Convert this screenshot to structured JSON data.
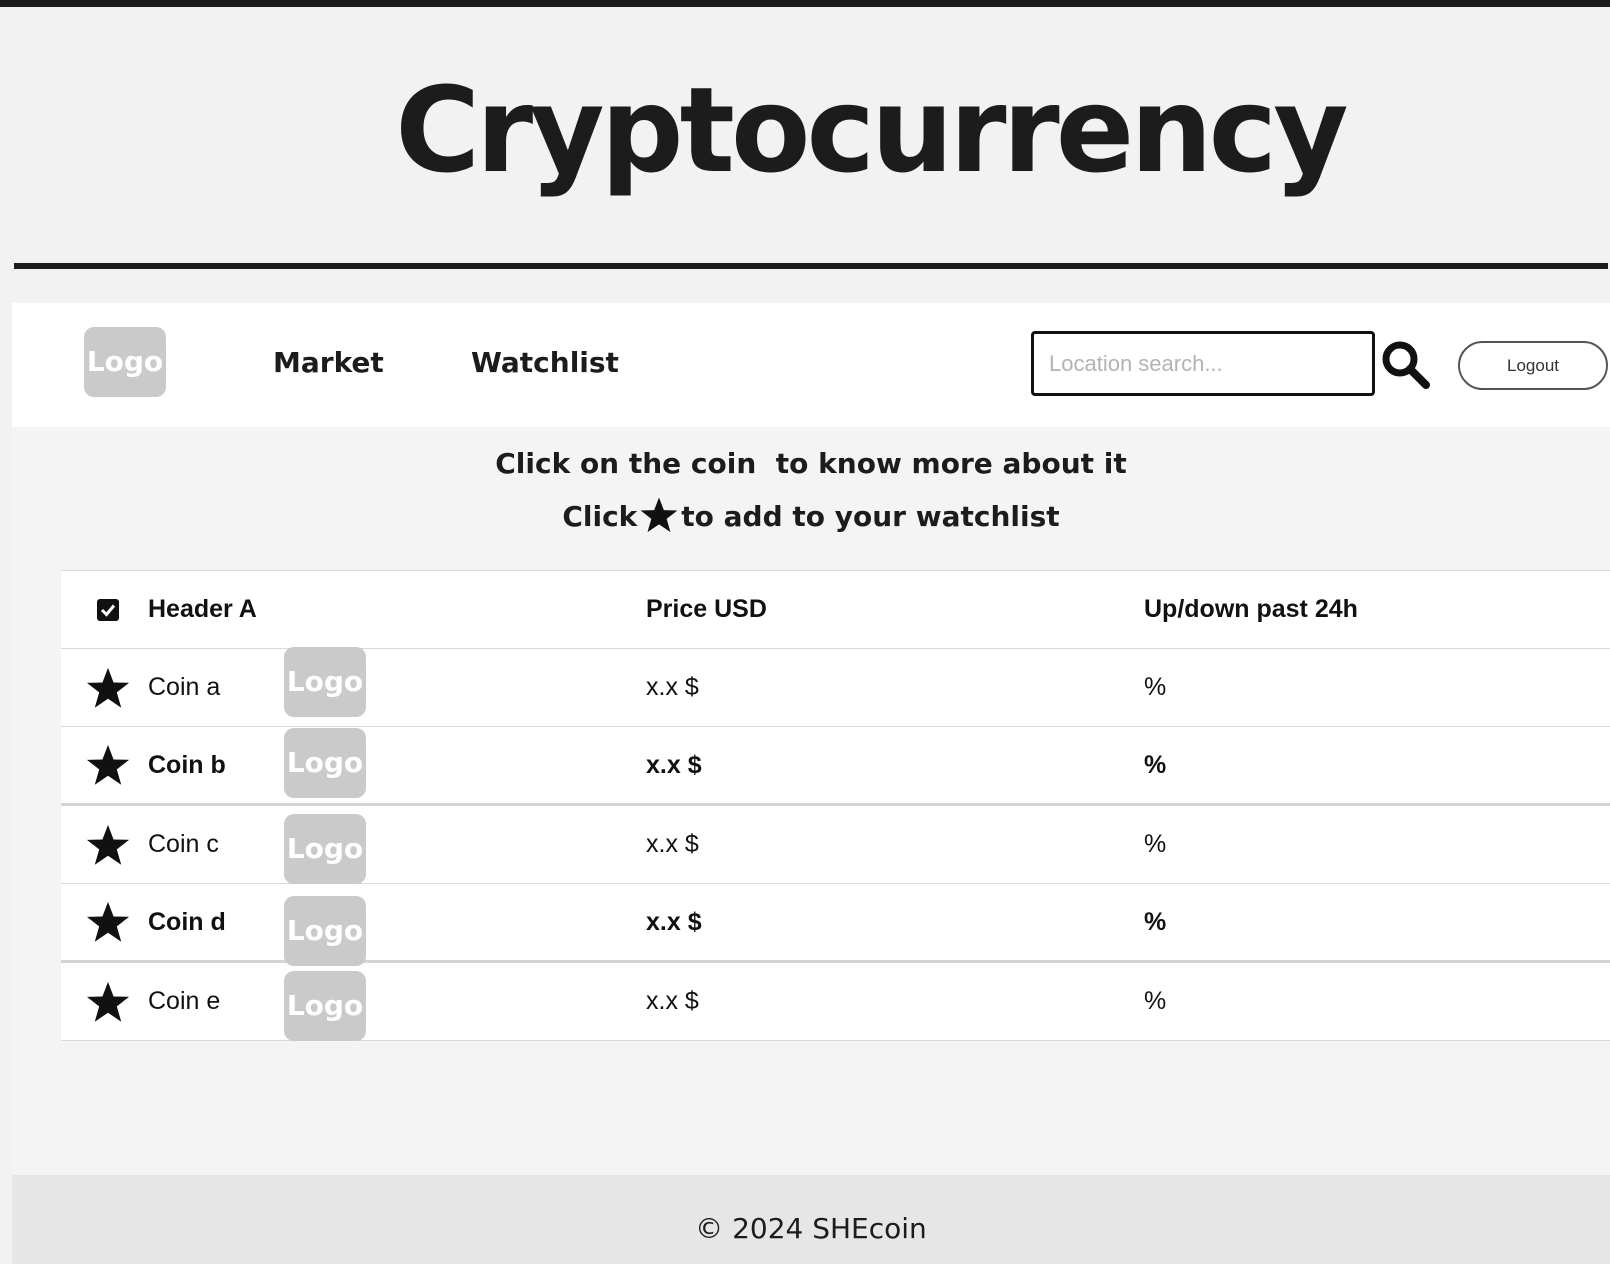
{
  "site": {
    "title": "Cryptocurrency"
  },
  "nav": {
    "logo_text": "Logo",
    "links": [
      "Market",
      "Watchlist"
    ],
    "search_placeholder": "Location search...",
    "logout_label": "Logout"
  },
  "instructions": {
    "line1": "Click on the coin  to know more about it",
    "line2_before": "Click",
    "line2_after": "to add to your watchlist"
  },
  "table": {
    "headers": [
      "Header A",
      "Price USD",
      "Up/down  past 24h"
    ],
    "logo_text": "Logo",
    "rows": [
      {
        "name": "Coin a",
        "price": "x.x $",
        "change": "%"
      },
      {
        "name": "Coin b",
        "price": "x.x $",
        "change": "%"
      },
      {
        "name": "Coin c",
        "price": "x.x $",
        "change": "%"
      },
      {
        "name": "Coin d",
        "price": "x.x $",
        "change": "%"
      },
      {
        "name": "Coin e",
        "price": "x.x $",
        "change": "%"
      }
    ]
  },
  "footer": {
    "text": "©  2024 SHEcoin"
  },
  "icons": {
    "star": "star-icon",
    "search": "search-icon",
    "checkbox": "checkbox-checked-icon"
  }
}
